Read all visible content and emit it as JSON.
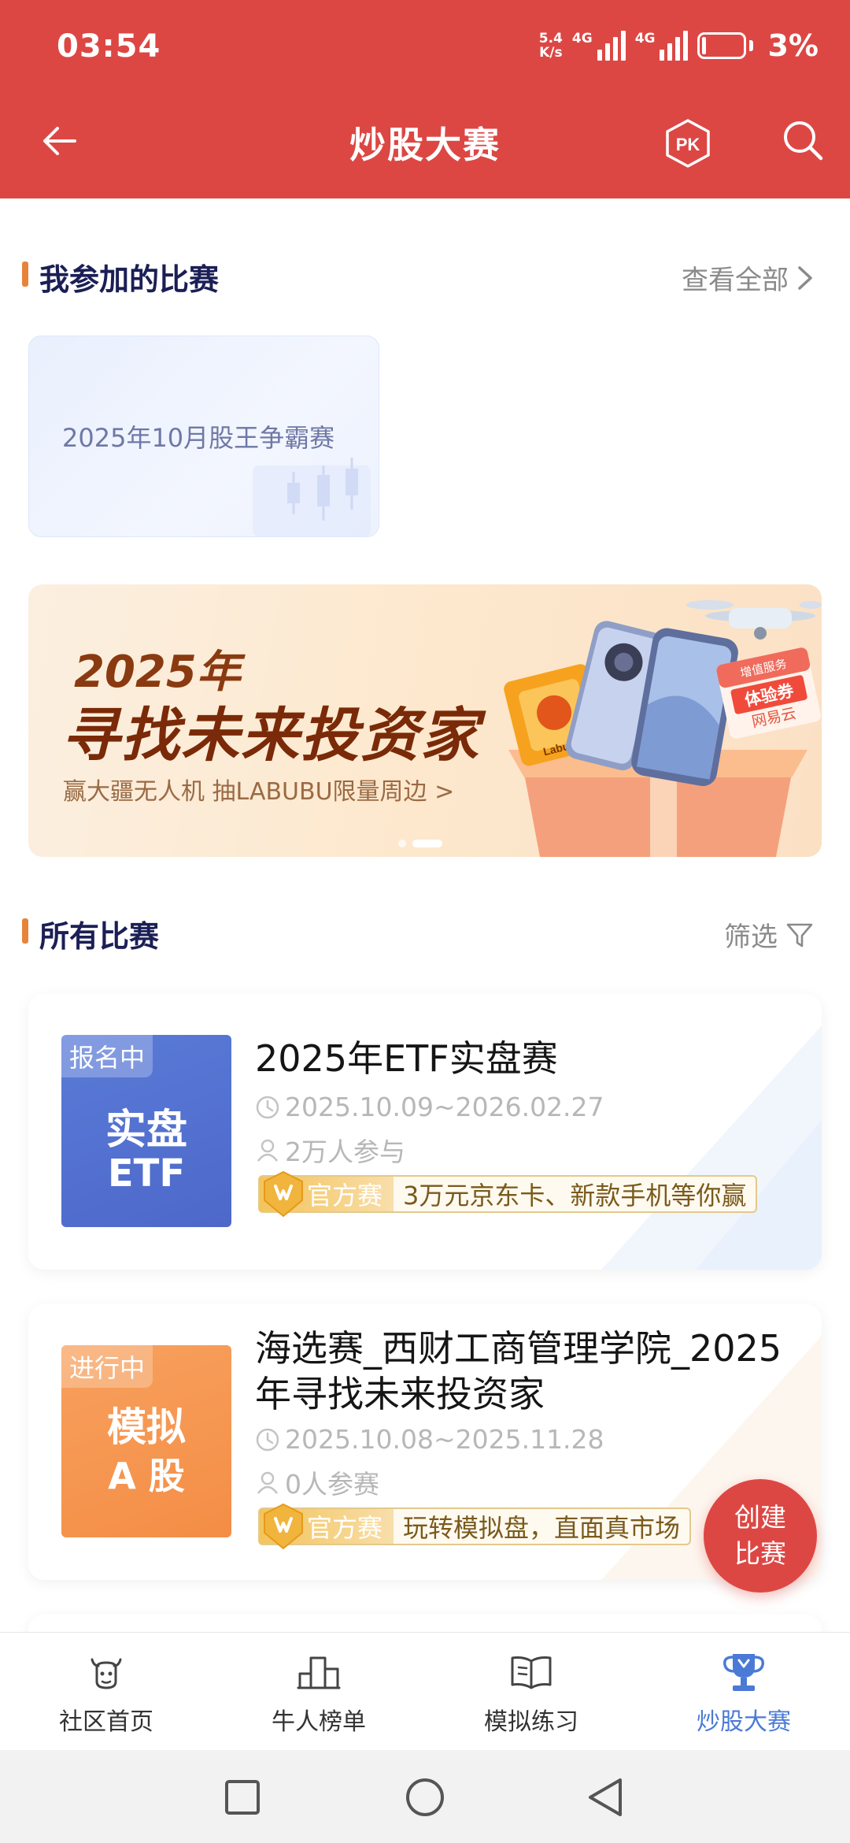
{
  "status_bar": {
    "time": "03:54",
    "net_speed_value": "5.4",
    "net_speed_unit": "K/s",
    "signal_1": "4G",
    "signal_2": "4G",
    "battery": "3%"
  },
  "nav": {
    "title": "炒股大赛",
    "pk_label": "PK"
  },
  "my_section": {
    "title": "我参加的比赛",
    "view_all": "查看全部"
  },
  "my_contests": [
    {
      "title": "2025年10月股王争霸赛"
    }
  ],
  "banner": {
    "year": "2025年",
    "headline": "寻找未来投资家",
    "subtitle": "赢大疆无人机 抽LABUBU限量周边 >",
    "voucher_line1": "增值服务",
    "voucher_line2": "体验券",
    "voucher_brand": "网易云",
    "box_label": "Labubu"
  },
  "all_section": {
    "title": "所有比赛",
    "filter": "筛选"
  },
  "contests": [
    {
      "status": "报名中",
      "thumb_line1": "实盘",
      "thumb_line2": "ETF",
      "title": "2025年ETF实盘赛",
      "dates": "2025.10.09~2026.02.27",
      "participants": "2万人参与",
      "badge": "官方赛",
      "promo": "3万元京东卡、新款手机等你赢"
    },
    {
      "status": "进行中",
      "thumb_line1": "模拟",
      "thumb_line2": "A 股",
      "title_line1": "海选赛_西财工商管理学院_2025",
      "title_line2": "年寻找未来投资家",
      "dates": "2025.10.08~2025.11.28",
      "participants": "0人参赛",
      "badge": "官方赛",
      "promo": "玩转模拟盘，直面真市场"
    }
  ],
  "fab": {
    "line1": "创建",
    "line2": "比赛"
  },
  "tabs": [
    {
      "label": "社区首页",
      "icon": "cow-icon"
    },
    {
      "label": "牛人榜单",
      "icon": "podium-icon"
    },
    {
      "label": "模拟练习",
      "icon": "book-icon"
    },
    {
      "label": "炒股大赛",
      "icon": "trophy-icon"
    }
  ],
  "colors": {
    "header": "#dc4744",
    "accent_bar": "#e7843b",
    "active_tab": "#4a7ad6",
    "section_title": "#1b1f55"
  }
}
